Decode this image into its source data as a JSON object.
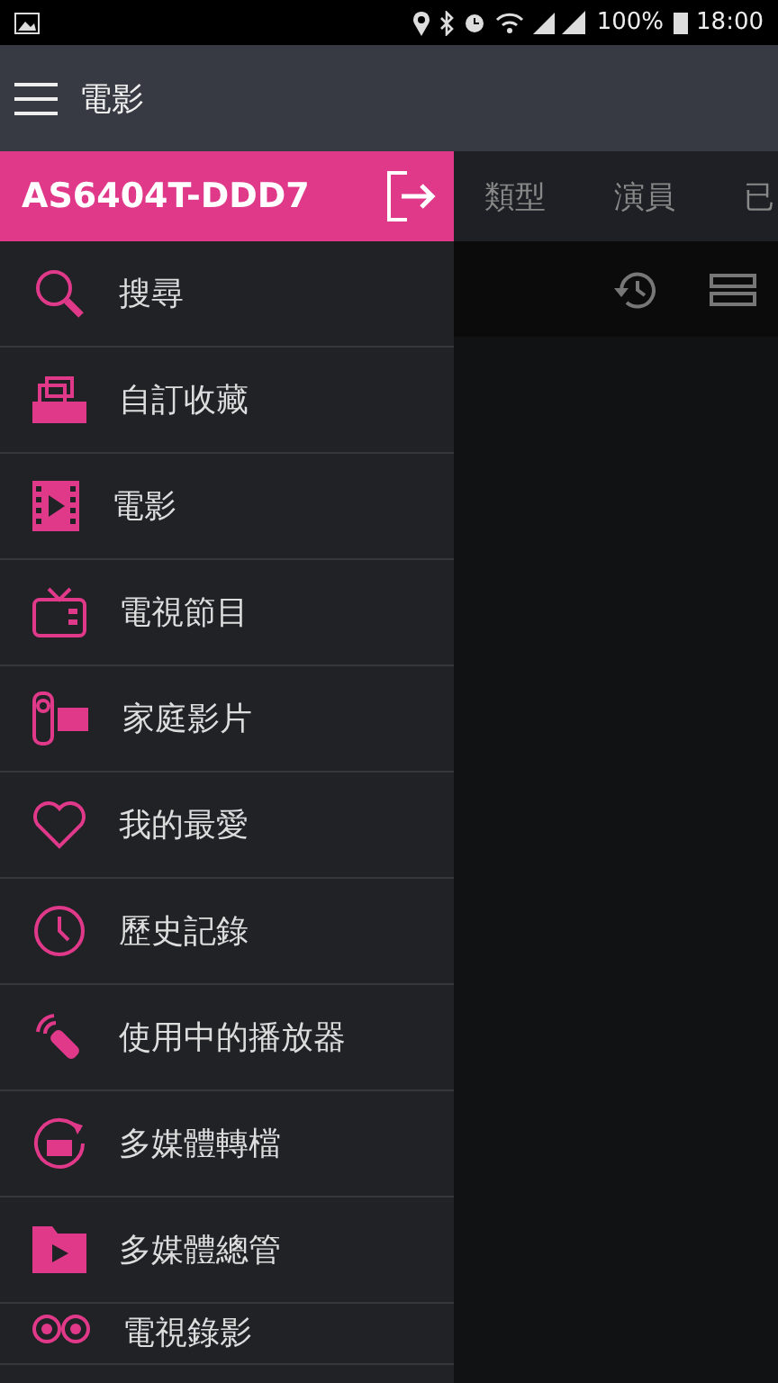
{
  "status_bar": {
    "battery": "100%",
    "time": "18:00"
  },
  "app_bar": {
    "title": "電影"
  },
  "drawer": {
    "header": "AS6404T-DDD7",
    "items": [
      {
        "kind": "search",
        "label": "搜尋"
      },
      {
        "kind": "collection",
        "label": "自訂收藏"
      },
      {
        "kind": "film",
        "label": "電影"
      },
      {
        "kind": "tv",
        "label": "電視節目"
      },
      {
        "kind": "camcorder",
        "label": "家庭影片"
      },
      {
        "kind": "heart",
        "label": "我的最愛"
      },
      {
        "kind": "clock",
        "label": "歷史記錄"
      },
      {
        "kind": "remote",
        "label": "使用中的播放器"
      },
      {
        "kind": "convert",
        "label": "多媒體轉檔"
      },
      {
        "kind": "folder",
        "label": "多媒體總管"
      },
      {
        "kind": "record",
        "label": "電視錄影"
      }
    ]
  },
  "tabs": [
    {
      "label": "類型"
    },
    {
      "label": "演員"
    },
    {
      "label": "已"
    }
  ]
}
